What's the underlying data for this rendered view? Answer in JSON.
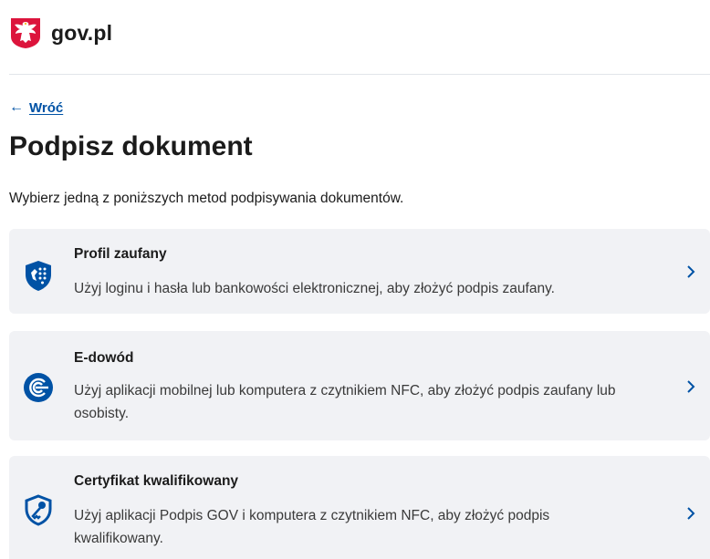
{
  "header": {
    "brand": "gov.pl",
    "emblem_icon": "polish-eagle-emblem-icon"
  },
  "nav": {
    "back_label": "Wróć",
    "back_icon": "arrow-left-icon"
  },
  "page": {
    "title": "Podpisz dokument",
    "intro": "Wybierz jedną z poniższych metod podpisywania dokumentów."
  },
  "methods": [
    {
      "title": "Profil zaufany",
      "description": "Użyj loginu i hasła lub bankowości elektronicznej, aby złożyć podpis zaufany.",
      "icon": "trusted-profile-shield-icon"
    },
    {
      "title": "E-dowód",
      "description": "Użyj aplikacji mobilnej lub komputera z czytnikiem NFC, aby złożyć podpis zaufany lub osobisty.",
      "icon": "e-id-card-icon"
    },
    {
      "title": "Certyfikat kwalifikowany",
      "description": "Użyj aplikacji Podpis GOV i komputera z czytnikiem NFC, aby złożyć podpis kwalifikowany.",
      "icon": "qualified-certificate-shield-icon"
    }
  ],
  "colors": {
    "accent": "#0052a5",
    "card_background": "#f1f2f5",
    "flag_red": "#dc143c"
  }
}
